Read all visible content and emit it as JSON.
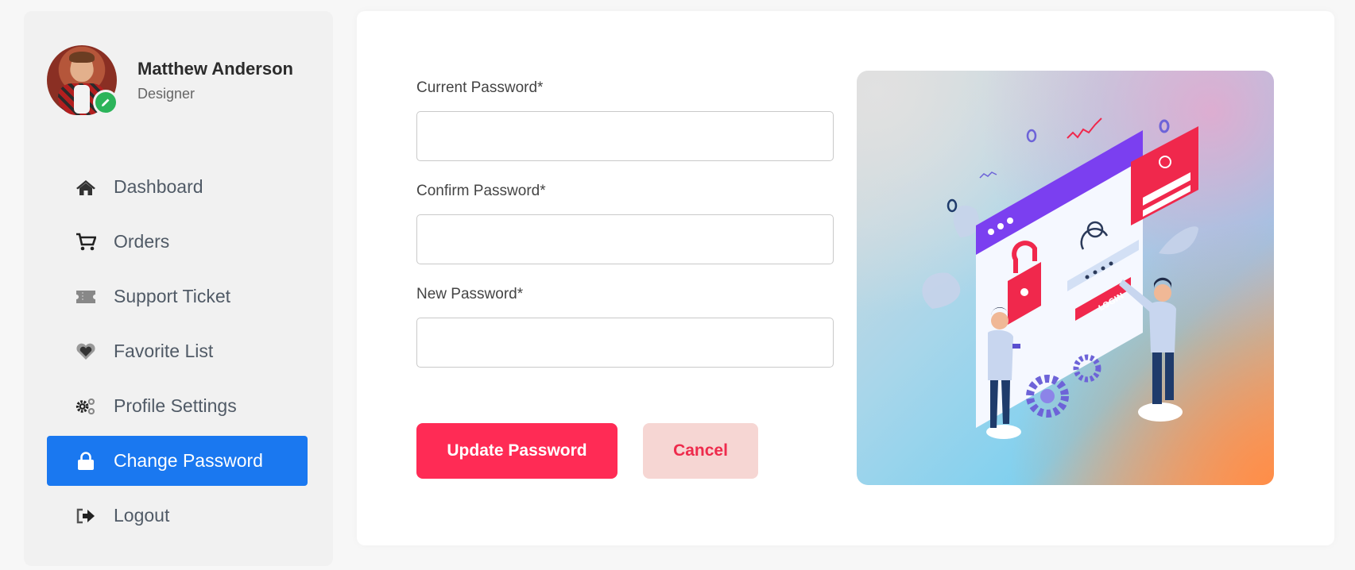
{
  "profile": {
    "name": "Matthew Anderson",
    "role": "Designer"
  },
  "menu": [
    {
      "label": "Dashboard",
      "icon": "home-icon"
    },
    {
      "label": "Orders",
      "icon": "cart-icon"
    },
    {
      "label": "Support Ticket",
      "icon": "ticket-icon"
    },
    {
      "label": "Favorite List",
      "icon": "heart-icon"
    },
    {
      "label": "Profile Settings",
      "icon": "gears-icon"
    },
    {
      "label": "Change Password",
      "icon": "lock-icon",
      "active": true
    },
    {
      "label": "Logout",
      "icon": "logout-icon"
    }
  ],
  "form": {
    "current_label": "Current Password*",
    "current_value": "",
    "confirm_label": "Confirm Password*",
    "confirm_value": "",
    "new_label": "New Password*",
    "new_value": "",
    "update_button": "Update Password",
    "cancel_button": "Cancel"
  },
  "illustration": {
    "login_text": "LOGIN"
  },
  "colors": {
    "accent_blue": "#1a78f0",
    "primary_red": "#ff2b55",
    "cancel_bg": "#f6d6d3",
    "edit_green": "#2cb45a"
  }
}
